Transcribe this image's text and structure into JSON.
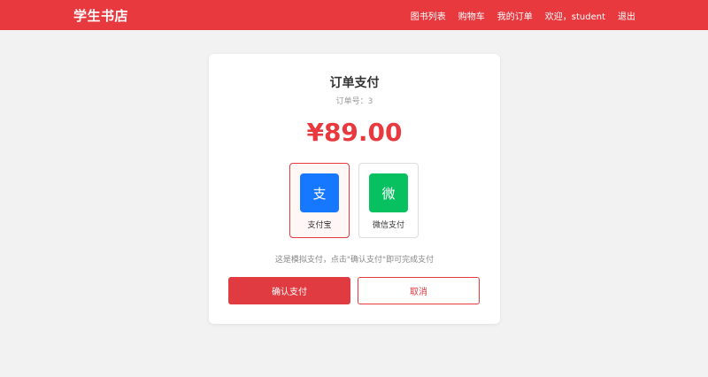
{
  "header": {
    "brand": "学生书店",
    "nav": [
      "图书列表",
      "购物车",
      "我的订单",
      "欢迎，student",
      "退出"
    ]
  },
  "payment": {
    "title": "订单支付",
    "order_no": "订单号：3",
    "amount": "¥89.00",
    "methods": [
      {
        "icon_char": "支",
        "label": "支付宝",
        "icon": "alipay-icon",
        "color": "#1677ff",
        "selected": true
      },
      {
        "icon_char": "微",
        "label": "微信支付",
        "icon": "wechat-icon",
        "color": "#07c160",
        "selected": false
      }
    ],
    "hint": "这是模拟支付，点击\"确认支付\"即可完成支付",
    "confirm_label": "确认支付",
    "cancel_label": "取消"
  },
  "colors": {
    "accent": "#e8393f"
  }
}
